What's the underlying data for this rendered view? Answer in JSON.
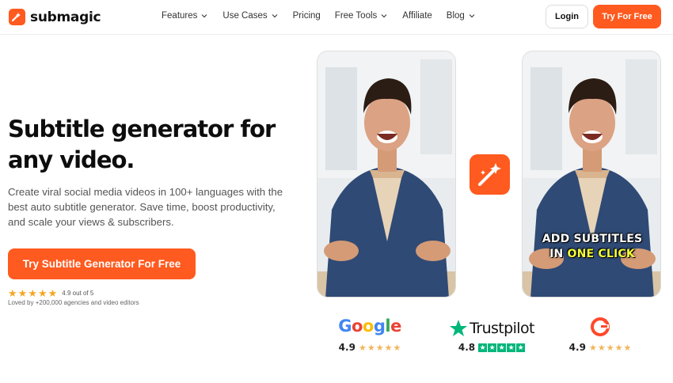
{
  "brand": {
    "name": "submagic",
    "accent": "#ff5a1f"
  },
  "nav": {
    "items": [
      {
        "label": "Features",
        "dropdown": true
      },
      {
        "label": "Use Cases",
        "dropdown": true
      },
      {
        "label": "Pricing",
        "dropdown": false
      },
      {
        "label": "Free Tools",
        "dropdown": true
      },
      {
        "label": "Affiliate",
        "dropdown": false
      },
      {
        "label": "Blog",
        "dropdown": true
      }
    ],
    "login_label": "Login",
    "try_label": "Try For Free"
  },
  "hero": {
    "headline_line1": "Subtitle generator for",
    "headline_line2": "any video.",
    "description": "Create viral social media videos in 100+ languages with the best auto subtitle generator. Save time, boost productivity, and scale your views & subscribers.",
    "cta_label": "Try Subtitle Generator For Free",
    "rating_text": "4.9 out of 5",
    "rating_value": 4.9,
    "loved_text": "Loved by +200,000 agencies and video editors"
  },
  "preview": {
    "caption_line1": "ADD SUBTITLES",
    "caption_line2_pre": "IN ",
    "caption_line2_hl": "ONE CLICK",
    "magic_icon": "magic-wand-icon"
  },
  "reviews": {
    "google": {
      "brand": "Google",
      "score": "4.9",
      "stars": 5
    },
    "trustpilot": {
      "brand": "Trustpilot",
      "score": "4.8",
      "stars": 5
    },
    "g2": {
      "brand": "G2",
      "score": "4.9",
      "stars": 5
    }
  }
}
